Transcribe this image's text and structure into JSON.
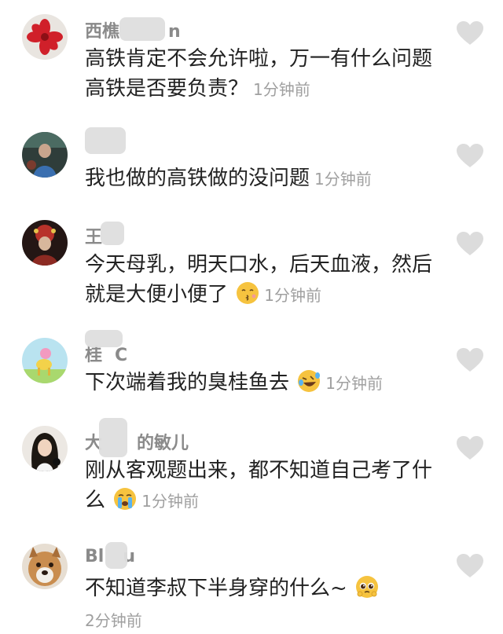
{
  "comments": [
    {
      "name": "西樵",
      "name_suffix": "n",
      "text": "高铁肯定不会允许啦，万一有什么问题高铁是否要负责？",
      "time": "1分钟前",
      "emoji": ""
    },
    {
      "name": "",
      "name_suffix": "",
      "text": "我也做的高铁做的没问题",
      "time": "1分钟前",
      "emoji": ""
    },
    {
      "name": "王",
      "name_suffix": "",
      "text": "今天母乳，明天口水，后天血液，然后就是大便小便了",
      "time": "1分钟前",
      "emoji": "kissing-face"
    },
    {
      "name": "桂",
      "name_suffix": "C",
      "text": "下次端着我的臭桂鱼去",
      "time": "1分钟前",
      "emoji": "rofl-face"
    },
    {
      "name": "大",
      "name_suffix": "的敏儿",
      "text": "刚从客观题出来，都不知道自己考了什么",
      "time": "1分钟前",
      "emoji": "crying-face"
    },
    {
      "name": "Bl",
      "name_suffix": "u",
      "text": "不知道李叔下半身穿的什么~",
      "time": "2分钟前",
      "emoji": "pleading-face"
    }
  ],
  "colors": {
    "name": "#8a8a8a",
    "text": "#222222",
    "time": "#a0a0a0",
    "heart": "#dcdcdc"
  }
}
